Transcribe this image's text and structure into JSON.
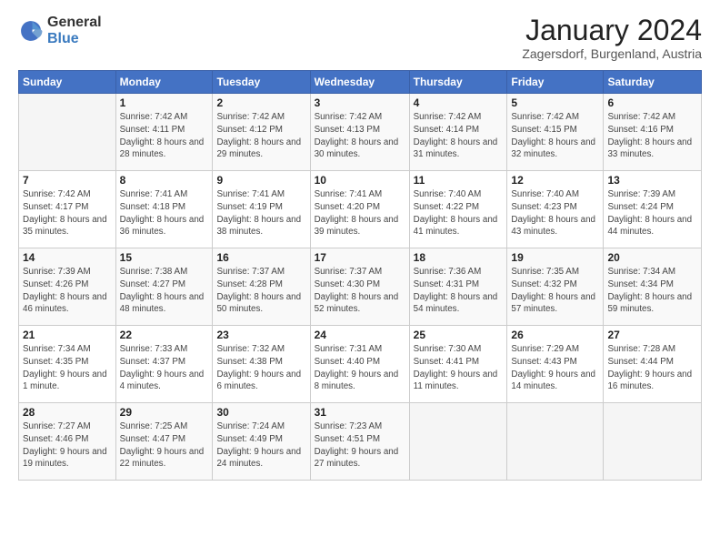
{
  "logo": {
    "general": "General",
    "blue": "Blue"
  },
  "header": {
    "title": "January 2024",
    "subtitle": "Zagersdorf, Burgenland, Austria"
  },
  "weekdays": [
    "Sunday",
    "Monday",
    "Tuesday",
    "Wednesday",
    "Thursday",
    "Friday",
    "Saturday"
  ],
  "weeks": [
    [
      {
        "day": "",
        "sunrise": "",
        "sunset": "",
        "daylight": ""
      },
      {
        "day": "1",
        "sunrise": "Sunrise: 7:42 AM",
        "sunset": "Sunset: 4:11 PM",
        "daylight": "Daylight: 8 hours and 28 minutes."
      },
      {
        "day": "2",
        "sunrise": "Sunrise: 7:42 AM",
        "sunset": "Sunset: 4:12 PM",
        "daylight": "Daylight: 8 hours and 29 minutes."
      },
      {
        "day": "3",
        "sunrise": "Sunrise: 7:42 AM",
        "sunset": "Sunset: 4:13 PM",
        "daylight": "Daylight: 8 hours and 30 minutes."
      },
      {
        "day": "4",
        "sunrise": "Sunrise: 7:42 AM",
        "sunset": "Sunset: 4:14 PM",
        "daylight": "Daylight: 8 hours and 31 minutes."
      },
      {
        "day": "5",
        "sunrise": "Sunrise: 7:42 AM",
        "sunset": "Sunset: 4:15 PM",
        "daylight": "Daylight: 8 hours and 32 minutes."
      },
      {
        "day": "6",
        "sunrise": "Sunrise: 7:42 AM",
        "sunset": "Sunset: 4:16 PM",
        "daylight": "Daylight: 8 hours and 33 minutes."
      }
    ],
    [
      {
        "day": "7",
        "sunrise": "Sunrise: 7:42 AM",
        "sunset": "Sunset: 4:17 PM",
        "daylight": "Daylight: 8 hours and 35 minutes."
      },
      {
        "day": "8",
        "sunrise": "Sunrise: 7:41 AM",
        "sunset": "Sunset: 4:18 PM",
        "daylight": "Daylight: 8 hours and 36 minutes."
      },
      {
        "day": "9",
        "sunrise": "Sunrise: 7:41 AM",
        "sunset": "Sunset: 4:19 PM",
        "daylight": "Daylight: 8 hours and 38 minutes."
      },
      {
        "day": "10",
        "sunrise": "Sunrise: 7:41 AM",
        "sunset": "Sunset: 4:20 PM",
        "daylight": "Daylight: 8 hours and 39 minutes."
      },
      {
        "day": "11",
        "sunrise": "Sunrise: 7:40 AM",
        "sunset": "Sunset: 4:22 PM",
        "daylight": "Daylight: 8 hours and 41 minutes."
      },
      {
        "day": "12",
        "sunrise": "Sunrise: 7:40 AM",
        "sunset": "Sunset: 4:23 PM",
        "daylight": "Daylight: 8 hours and 43 minutes."
      },
      {
        "day": "13",
        "sunrise": "Sunrise: 7:39 AM",
        "sunset": "Sunset: 4:24 PM",
        "daylight": "Daylight: 8 hours and 44 minutes."
      }
    ],
    [
      {
        "day": "14",
        "sunrise": "Sunrise: 7:39 AM",
        "sunset": "Sunset: 4:26 PM",
        "daylight": "Daylight: 8 hours and 46 minutes."
      },
      {
        "day": "15",
        "sunrise": "Sunrise: 7:38 AM",
        "sunset": "Sunset: 4:27 PM",
        "daylight": "Daylight: 8 hours and 48 minutes."
      },
      {
        "day": "16",
        "sunrise": "Sunrise: 7:37 AM",
        "sunset": "Sunset: 4:28 PM",
        "daylight": "Daylight: 8 hours and 50 minutes."
      },
      {
        "day": "17",
        "sunrise": "Sunrise: 7:37 AM",
        "sunset": "Sunset: 4:30 PM",
        "daylight": "Daylight: 8 hours and 52 minutes."
      },
      {
        "day": "18",
        "sunrise": "Sunrise: 7:36 AM",
        "sunset": "Sunset: 4:31 PM",
        "daylight": "Daylight: 8 hours and 54 minutes."
      },
      {
        "day": "19",
        "sunrise": "Sunrise: 7:35 AM",
        "sunset": "Sunset: 4:32 PM",
        "daylight": "Daylight: 8 hours and 57 minutes."
      },
      {
        "day": "20",
        "sunrise": "Sunrise: 7:34 AM",
        "sunset": "Sunset: 4:34 PM",
        "daylight": "Daylight: 8 hours and 59 minutes."
      }
    ],
    [
      {
        "day": "21",
        "sunrise": "Sunrise: 7:34 AM",
        "sunset": "Sunset: 4:35 PM",
        "daylight": "Daylight: 9 hours and 1 minute."
      },
      {
        "day": "22",
        "sunrise": "Sunrise: 7:33 AM",
        "sunset": "Sunset: 4:37 PM",
        "daylight": "Daylight: 9 hours and 4 minutes."
      },
      {
        "day": "23",
        "sunrise": "Sunrise: 7:32 AM",
        "sunset": "Sunset: 4:38 PM",
        "daylight": "Daylight: 9 hours and 6 minutes."
      },
      {
        "day": "24",
        "sunrise": "Sunrise: 7:31 AM",
        "sunset": "Sunset: 4:40 PM",
        "daylight": "Daylight: 9 hours and 8 minutes."
      },
      {
        "day": "25",
        "sunrise": "Sunrise: 7:30 AM",
        "sunset": "Sunset: 4:41 PM",
        "daylight": "Daylight: 9 hours and 11 minutes."
      },
      {
        "day": "26",
        "sunrise": "Sunrise: 7:29 AM",
        "sunset": "Sunset: 4:43 PM",
        "daylight": "Daylight: 9 hours and 14 minutes."
      },
      {
        "day": "27",
        "sunrise": "Sunrise: 7:28 AM",
        "sunset": "Sunset: 4:44 PM",
        "daylight": "Daylight: 9 hours and 16 minutes."
      }
    ],
    [
      {
        "day": "28",
        "sunrise": "Sunrise: 7:27 AM",
        "sunset": "Sunset: 4:46 PM",
        "daylight": "Daylight: 9 hours and 19 minutes."
      },
      {
        "day": "29",
        "sunrise": "Sunrise: 7:25 AM",
        "sunset": "Sunset: 4:47 PM",
        "daylight": "Daylight: 9 hours and 22 minutes."
      },
      {
        "day": "30",
        "sunrise": "Sunrise: 7:24 AM",
        "sunset": "Sunset: 4:49 PM",
        "daylight": "Daylight: 9 hours and 24 minutes."
      },
      {
        "day": "31",
        "sunrise": "Sunrise: 7:23 AM",
        "sunset": "Sunset: 4:51 PM",
        "daylight": "Daylight: 9 hours and 27 minutes."
      },
      {
        "day": "",
        "sunrise": "",
        "sunset": "",
        "daylight": ""
      },
      {
        "day": "",
        "sunrise": "",
        "sunset": "",
        "daylight": ""
      },
      {
        "day": "",
        "sunrise": "",
        "sunset": "",
        "daylight": ""
      }
    ]
  ]
}
